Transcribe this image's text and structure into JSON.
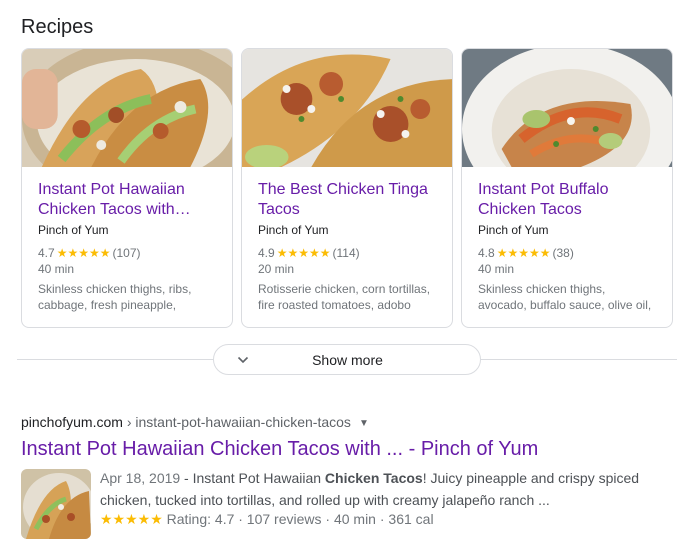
{
  "section_title": "Recipes",
  "cards": [
    {
      "title_line1": "Instant Pot Hawaiian",
      "title_line2": "Chicken Tacos with…",
      "source": "Pinch of Yum",
      "rating": "4.7",
      "stars": "★★★★★",
      "reviews": "(107)",
      "time": "40 min",
      "ingredients_line1": "Skinless chicken thighs, ribs,",
      "ingredients_line2": "cabbage, fresh pineapple,"
    },
    {
      "title_line1": "The Best Chicken Tinga",
      "title_line2": "Tacos",
      "source": "Pinch of Yum",
      "rating": "4.9",
      "stars": "★★★★★",
      "reviews": "(114)",
      "time": "20 min",
      "ingredients_line1": "Rotisserie chicken, corn tortillas,",
      "ingredients_line2": "fire roasted tomatoes, adobo"
    },
    {
      "title_line1": "Instant Pot Buffalo",
      "title_line2": "Chicken Tacos",
      "source": "Pinch of Yum",
      "rating": "4.8",
      "stars": "★★★★★",
      "reviews": "(38)",
      "time": "40 min",
      "ingredients_line1": "Skinless chicken thighs,",
      "ingredients_line2": "avocado, buffalo sauce, olive oil,"
    }
  ],
  "show_more_label": "Show more",
  "result": {
    "domain": "pinchofyum.com",
    "path": " › instant-pot-hawaiian-chicken-tacos",
    "title": "Instant Pot Hawaiian Chicken Tacos with ... - Pinch of Yum",
    "date": "Apr 18, 2019",
    "snippet_pre": " - Instant Pot Hawaiian ",
    "snippet_bold": "Chicken Tacos",
    "snippet_post": "! Juicy pineapple and crispy spiced chicken, tucked into tortillas, and rolled up with creamy jalapeño ranch ...",
    "stars": "★★★★★",
    "rich_text": " Rating: 4.7 · 107 reviews · 40 min · 361 cal"
  },
  "colors": {
    "visited_link": "#681da8",
    "star": "#fbbc04",
    "border": "#dadce0",
    "meta_text": "#70757a"
  },
  "icons": [
    "chevron-down-icon",
    "dropdown-caret-icon",
    "star-icon"
  ]
}
